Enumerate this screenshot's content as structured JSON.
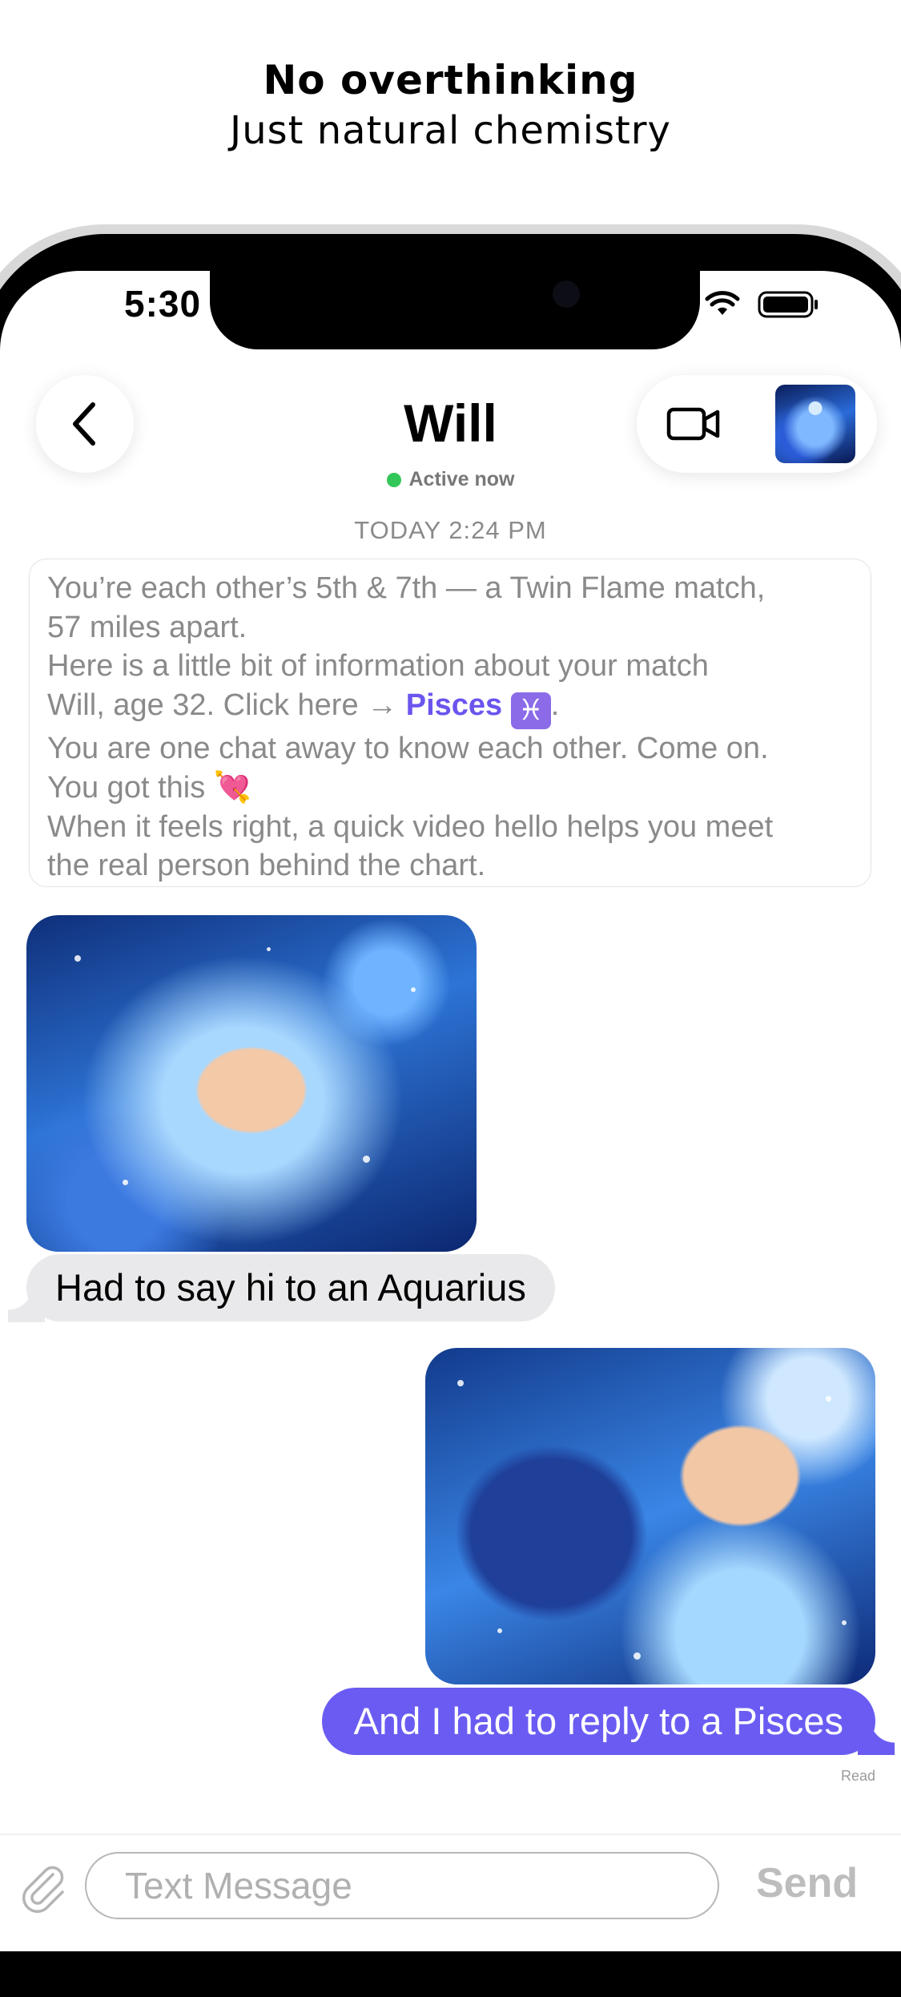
{
  "promo": {
    "headline": "No overthinking",
    "subheadline": "Just natural chemistry"
  },
  "status_bar": {
    "time": "5:30",
    "icons": [
      "wifi-icon",
      "battery-icon"
    ]
  },
  "header": {
    "back_icon": "chevron-left-icon",
    "contact_name": "Will",
    "presence": "Active now",
    "presence_color": "#33c759",
    "video_icon": "video-camera-icon",
    "avatar": "contact-avatar-image"
  },
  "conversation": {
    "timestamp": "TODAY 2:24 PM",
    "intro_card": {
      "line1": "You’re each other’s 5th & 7th — a Twin Flame match,",
      "line2": "57 miles apart.",
      "line3": "Here is a little bit of information about your match",
      "line4_prefix": "Will, age 32. Click here → ",
      "line4_link": "Pisces",
      "line4_sign": "♓",
      "line4_suffix": ".",
      "line5": "You are one chat away to know each other. Come on.",
      "line6_text": "You got this ",
      "line6_emoji": "💘",
      "line7": "When it feels right, a quick video hello helps you meet",
      "line8": "the real person behind the chart."
    },
    "messages": [
      {
        "direction": "incoming",
        "image": "aquarius-chibi-illustration",
        "text": "Had to say hi to an Aquarius"
      },
      {
        "direction": "outgoing",
        "image": "water-bearer-chibi-illustration",
        "text": "And I had to reply to a Pisces",
        "receipt": "Read"
      }
    ]
  },
  "composer": {
    "attach_icon": "paperclip-icon",
    "placeholder": "Text Message",
    "value": "",
    "send_label": "Send"
  },
  "colors": {
    "accent": "#6a5cf2",
    "link": "#6a55ee",
    "incoming_bubble": "#e9e9eb",
    "muted_text": "#8a8a8a"
  }
}
